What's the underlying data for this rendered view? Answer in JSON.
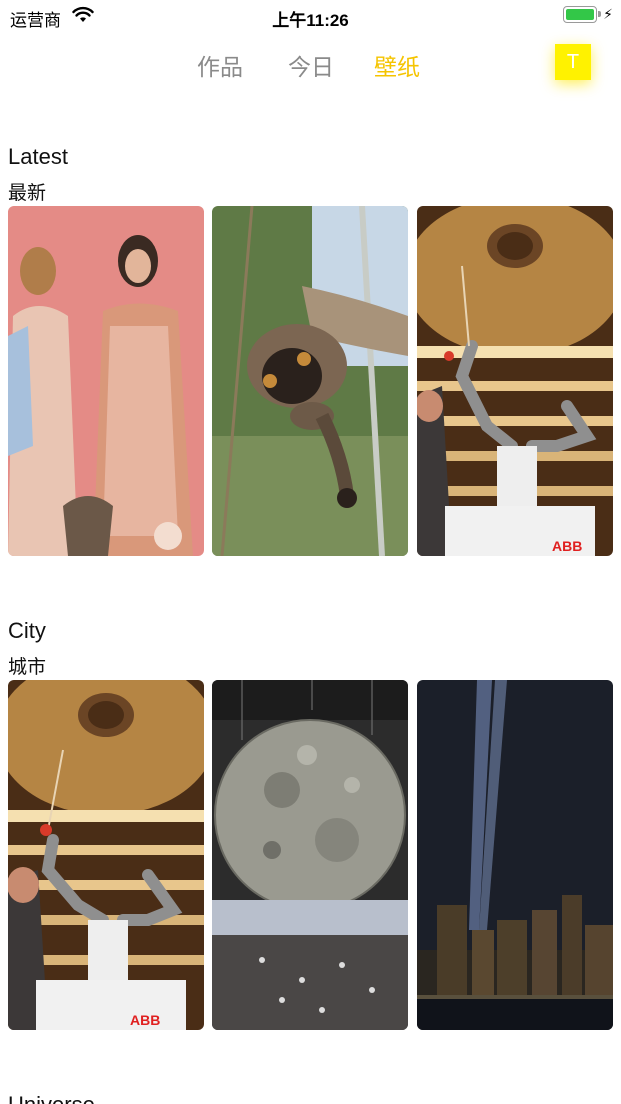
{
  "status_bar": {
    "carrier": "运营商",
    "time": "上午11:26",
    "battery_color": "#33c748"
  },
  "nav": {
    "tabs": [
      {
        "label": "作品",
        "active": false
      },
      {
        "label": "今日",
        "active": false
      },
      {
        "label": "壁纸",
        "active": true
      }
    ],
    "avatar_letter": "T",
    "accent_color": "#f5c400"
  },
  "sections": [
    {
      "title_en": "Latest",
      "title_cn": "最新",
      "thumbs": [
        {
          "subject": "fashion-models"
        },
        {
          "subject": "lemur"
        },
        {
          "subject": "robot-conductor-theater",
          "logo_text": "ABB"
        }
      ]
    },
    {
      "title_en": "City",
      "title_cn": "城市",
      "thumbs": [
        {
          "subject": "robot-conductor-theater",
          "logo_text": "ABB"
        },
        {
          "subject": "moon-installation"
        },
        {
          "subject": "tribute-in-light-skyline"
        }
      ]
    },
    {
      "title_en": "Universe"
    }
  ]
}
